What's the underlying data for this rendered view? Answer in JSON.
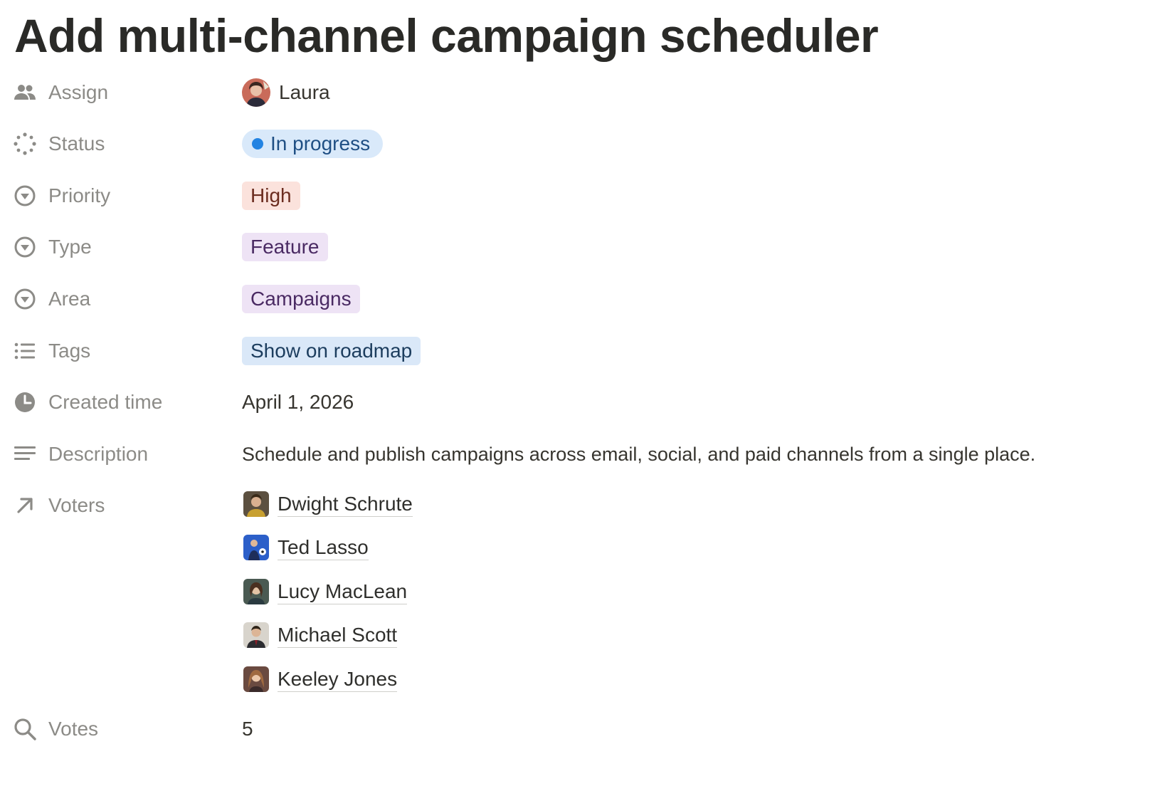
{
  "page": {
    "title": "Add multi-channel campaign scheduler"
  },
  "properties": {
    "assign": {
      "label": "Assign",
      "icon": "people-icon",
      "value": "Laura"
    },
    "status": {
      "label": "Status",
      "icon": "status-spinner-icon",
      "value": "In progress",
      "bg": "#d9e9fa",
      "text_color": "#1f4f84",
      "dot_color": "#2383e2"
    },
    "priority": {
      "label": "Priority",
      "icon": "select-circle-icon",
      "value": "High",
      "bg": "#fbe2dc",
      "text_color": "#6b2c1f"
    },
    "type": {
      "label": "Type",
      "icon": "select-circle-icon",
      "value": "Feature",
      "bg": "#eee3f5",
      "text_color": "#4a2a63"
    },
    "area": {
      "label": "Area",
      "icon": "select-circle-icon",
      "value": "Campaigns",
      "bg": "#eee3f5",
      "text_color": "#4a2a63"
    },
    "tags": {
      "label": "Tags",
      "icon": "list-icon",
      "value": "Show on roadmap",
      "bg": "#dae8f8",
      "text_color": "#1c3d5e"
    },
    "created_time": {
      "label": "Created time",
      "icon": "clock-icon",
      "value": "April 1, 2026"
    },
    "description": {
      "label": "Description",
      "icon": "text-lines-icon",
      "value": "Schedule and publish campaigns across email, social, and paid channels from a single place."
    },
    "voters": {
      "label": "Voters",
      "icon": "arrow-up-right-icon",
      "items": [
        {
          "name": "Dwight Schrute"
        },
        {
          "name": "Ted Lasso"
        },
        {
          "name": "Lucy MacLean"
        },
        {
          "name": "Michael Scott"
        },
        {
          "name": "Keeley Jones"
        }
      ]
    },
    "votes": {
      "label": "Votes",
      "icon": "search-icon",
      "value": "5"
    }
  }
}
